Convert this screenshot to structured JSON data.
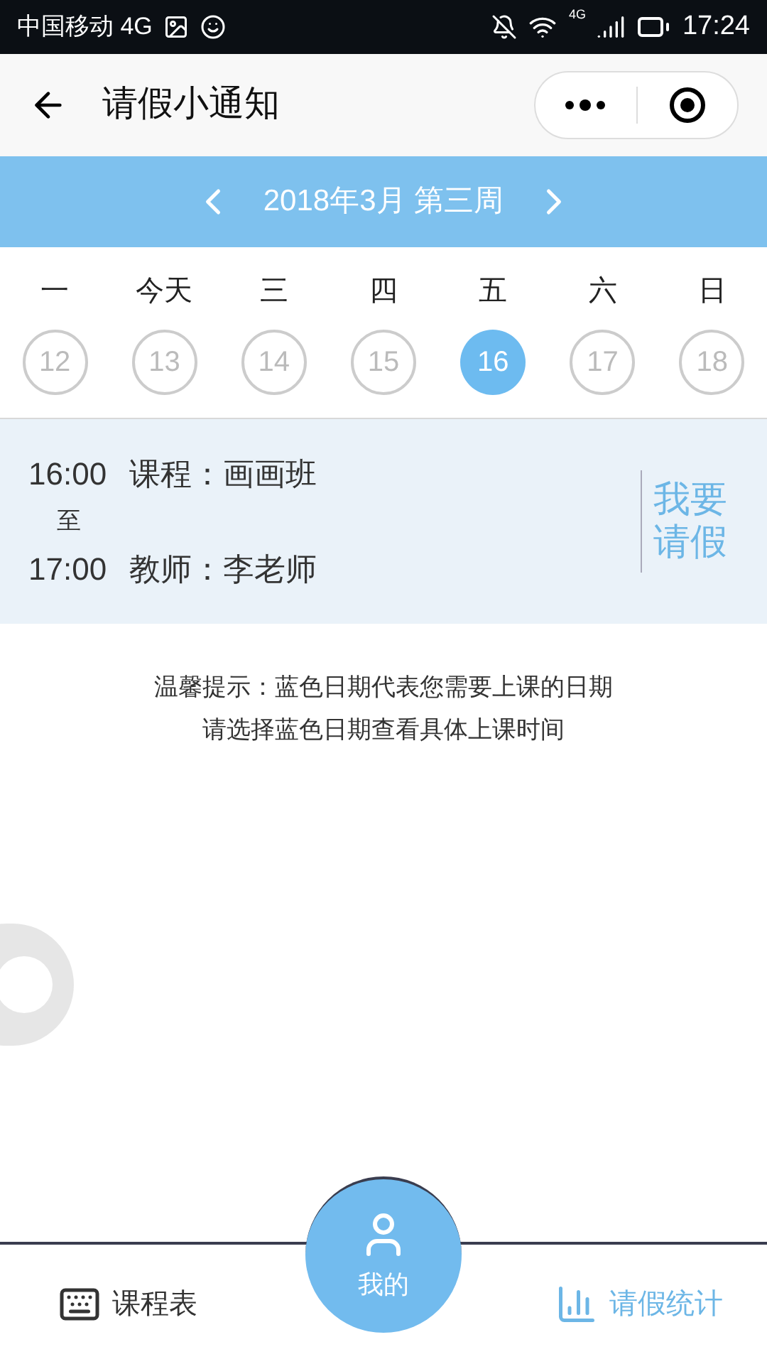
{
  "status_bar": {
    "carrier": "中国移动 4G",
    "network": "4G",
    "time": "17:24"
  },
  "header": {
    "title": "请假小通知"
  },
  "week_nav": {
    "label": "2018年3月 第三周"
  },
  "days": [
    {
      "weekday": "一",
      "date": "12",
      "selected": false
    },
    {
      "weekday": "今天",
      "date": "13",
      "selected": false
    },
    {
      "weekday": "三",
      "date": "14",
      "selected": false
    },
    {
      "weekday": "四",
      "date": "15",
      "selected": false
    },
    {
      "weekday": "五",
      "date": "16",
      "selected": true
    },
    {
      "weekday": "六",
      "date": "17",
      "selected": false
    },
    {
      "weekday": "日",
      "date": "18",
      "selected": false
    }
  ],
  "lesson": {
    "start": "16:00",
    "to": "至",
    "end": "17:00",
    "course": "课程：画画班",
    "teacher": "教师：李老师",
    "action": "我要请假"
  },
  "tips": [
    "温馨提示：蓝色日期代表您需要上课的日期",
    "请选择蓝色日期查看具体上课时间"
  ],
  "tab_bar": [
    {
      "kind": "side",
      "label": "课程表",
      "selected": false
    },
    {
      "kind": "center",
      "label": "我的",
      "selected": false
    },
    {
      "kind": "side",
      "label": "请假统计",
      "selected": true
    }
  ]
}
